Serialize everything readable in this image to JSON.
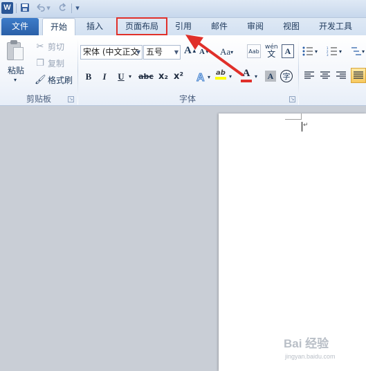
{
  "qat": {
    "logo": "W",
    "undo_arrow": "▾",
    "customize": "▾"
  },
  "tabs": {
    "file": "文件",
    "home": "开始",
    "insert": "插入",
    "page_layout": "页面布局",
    "references": "引用",
    "mailings": "邮件",
    "review": "审阅",
    "view": "视图",
    "developer": "开发工具"
  },
  "clipboard": {
    "paste": "粘贴",
    "cut": "剪切",
    "copy": "复制",
    "format_painter": "格式刷",
    "group_label": "剪贴板"
  },
  "font": {
    "font_name": "宋体 (中文正文",
    "font_size": "五号",
    "grow": "A",
    "shrink": "A",
    "change_case": "Aa",
    "bold": "B",
    "italic": "I",
    "underline": "U",
    "strikethrough": "abc",
    "subscript": "x₂",
    "superscript": "x²",
    "font_color": "A",
    "char_shading": "A",
    "enclose": "字",
    "phonetic": "wén",
    "group_label": "字体"
  },
  "watermark": {
    "text": "Bai 经验",
    "sub": "jingyan.baidu.com"
  },
  "colors": {
    "highlight_box": "#e0302a",
    "arrow": "#e0302a",
    "file_tab": "#2a5fa8",
    "font_color_bar": "#e0302a",
    "highlighter_bar": "#ffff00"
  }
}
